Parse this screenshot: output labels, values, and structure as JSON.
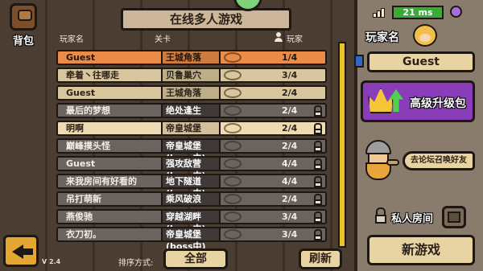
{
  "backpack": {
    "label": "背包"
  },
  "title": "在线多人游戏",
  "columns": {
    "player": "玩家名",
    "level": "关卡",
    "host": "玩家"
  },
  "rooms": [
    {
      "name": "Guest",
      "level": "王城角落",
      "count": "1/4",
      "style": "highlight",
      "locked": false
    },
    {
      "name": "牵着丶往哪走",
      "level": "贝鲁巢穴",
      "count": "3/4",
      "style": "light",
      "locked": false
    },
    {
      "name": "Guest",
      "level": "王城角落",
      "count": "2/4",
      "style": "light",
      "locked": false
    },
    {
      "name": "最后的梦想",
      "level": "绝处逢生",
      "count": "2/4",
      "style": "dark",
      "locked": true
    },
    {
      "name": "明啊",
      "level": "帝皇城堡",
      "count": "2/4",
      "style": "cream",
      "locked": true
    },
    {
      "name": "巅峰摸头怪",
      "level": "帝皇城堡(boss中)",
      "count": "2/4",
      "style": "dark",
      "locked": true
    },
    {
      "name": "Guest",
      "level": "强攻敌营(boss中)",
      "count": "4/4",
      "style": "dark",
      "locked": true
    },
    {
      "name": "来我房间有好看的",
      "level": "地下隧道(boss中)",
      "count": "4/4",
      "style": "dark",
      "locked": true
    },
    {
      "name": "吊打萌新",
      "level": "乘风破浪",
      "count": "2/4",
      "style": "dark",
      "locked": true
    },
    {
      "name": "燕俊驰",
      "level": "穿越湖畔(boss中)",
      "count": "3/4",
      "style": "dark",
      "locked": true
    },
    {
      "name": "衣刀初。",
      "level": "帝皇城堡(boss中)",
      "count": "3/4",
      "style": "dark",
      "locked": true
    }
  ],
  "bottom": {
    "version": "V 2.4",
    "sort_label": "排序方式:",
    "sort_value": "全部",
    "refresh": "刷新"
  },
  "status": {
    "ping": "21 ms"
  },
  "player": {
    "label": "玩家名",
    "name": "Guest"
  },
  "upgrade": {
    "label": "高级升级包"
  },
  "invite": {
    "label": "去论坛召唤好友"
  },
  "private_room": {
    "label": "私人房间"
  },
  "new_game": {
    "label": "新游戏"
  }
}
